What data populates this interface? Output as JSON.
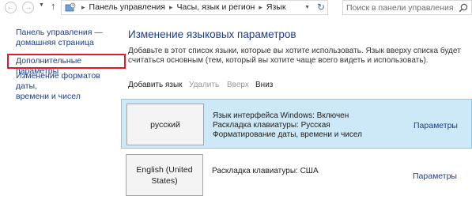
{
  "address_bar": {
    "breadcrumbs": [
      "Панель управления",
      "Часы, язык и регион",
      "Язык"
    ],
    "search_placeholder": "Поиск в панели управления"
  },
  "sidebar": {
    "links": [
      {
        "label": "Панель управления —\nдомашняя страница"
      },
      {
        "label": "Дополнительные параметры"
      },
      {
        "label": "Изменение форматов даты,\nвремени и чисел"
      }
    ]
  },
  "main": {
    "title": "Изменение языковых параметров",
    "description": "Добавьте в этот список языки, которые вы хотите использовать. Язык вверху списка будет считаться основным (тем, который вы хотите чаще всего видеть и использовать).",
    "toolbar": {
      "add": "Добавить язык",
      "remove": "Удалить",
      "up": "Вверх",
      "down": "Вниз"
    },
    "languages": [
      {
        "name": "русский",
        "details": [
          "Язык интерфейса Windows: Включен",
          "Раскладка клавиатуры: Русская",
          "Форматирование даты, времени и чисел"
        ],
        "link": "Параметры"
      },
      {
        "name": "English (United States)",
        "details": [
          "Раскладка клавиатуры: США"
        ],
        "link": "Параметры"
      }
    ]
  },
  "colors": {
    "link": "#1e3e8c",
    "title": "#1c3d96",
    "selected_row": "#cde8f7",
    "highlight": "#e5172b"
  }
}
